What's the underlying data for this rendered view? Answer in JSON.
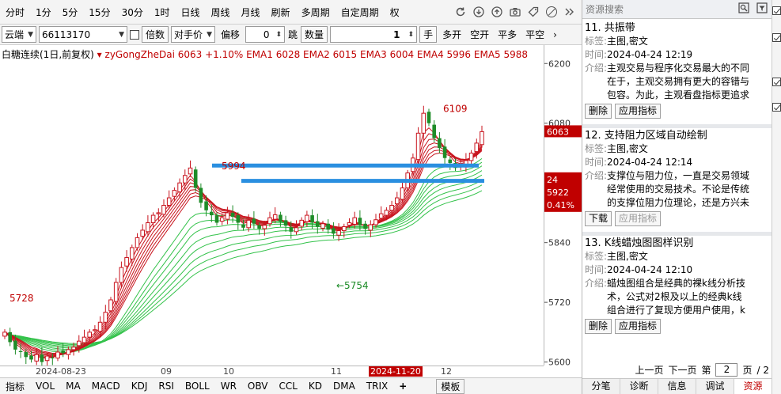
{
  "toolbar": {
    "items": [
      "分时",
      "1分",
      "5分",
      "15分",
      "30分",
      "1时",
      "日线",
      "周线",
      "月线",
      "刷新",
      "多周期",
      "自定周期",
      "权"
    ]
  },
  "controls": {
    "market": "云端",
    "code": "66113170",
    "multiplier_label": "倍数",
    "price_mode": "对手价",
    "offset_label": "偏移",
    "offset_value": "0",
    "jump_label": "跳",
    "qty_label": "数量",
    "qty_value": "1",
    "hand_label": "手",
    "actions": [
      "多开",
      "空开",
      "平多",
      "平空"
    ]
  },
  "chart_header": {
    "name": "白糖连续(1日,前复权)",
    "indicator": "zyGongZheDai",
    "values": "6063 +1.10%  EMA1 6028  EMA2 6015  EMA3 6004  EMA4 5996  EMA5 5988"
  },
  "chart_data": {
    "type": "candlestick",
    "title": "白糖连续(1日,前复权)",
    "indicator": "zyGongZheDai",
    "last_price": 6063,
    "change_pct": "+1.10%",
    "ema": {
      "EMA1": 6028,
      "EMA2": 6015,
      "EMA3": 6004,
      "EMA4": 5996,
      "EMA5": 5988
    },
    "y_ticks": [
      6200,
      6080,
      5960,
      5840,
      5720,
      5600
    ],
    "ylim": [
      5593,
      6237
    ],
    "x_labels": [
      "2024-08-23",
      "09",
      "10",
      "11",
      "2024-11-20",
      "12"
    ],
    "annotations": [
      {
        "text": "6109",
        "value": 6109
      },
      {
        "text": "5994",
        "value": 5994
      },
      {
        "text": "5754",
        "value": 5754
      },
      {
        "text": "5728",
        "value": 5728
      }
    ],
    "horizontal_lines": [
      5995,
      5964
    ],
    "price_tags": [
      "6063",
      "24",
      "5922",
      "0.41%"
    ],
    "closes": [
      5660,
      5640,
      5625,
      5620,
      5610,
      5605,
      5615,
      5600,
      5612,
      5608,
      5620,
      5618,
      5625,
      5630,
      5642,
      5650,
      5660,
      5665,
      5680,
      5700,
      5725,
      5760,
      5790,
      5810,
      5830,
      5850,
      5865,
      5880,
      5895,
      5900,
      5915,
      5930,
      5945,
      5960,
      5975,
      5990,
      5950,
      5920,
      5905,
      5895,
      5880,
      5890,
      5900,
      5892,
      5880,
      5870,
      5885,
      5878,
      5868,
      5875,
      5890,
      5896,
      5882,
      5874,
      5862,
      5870,
      5885,
      5895,
      5880,
      5872,
      5878,
      5866,
      5858,
      5864,
      5872,
      5880,
      5890,
      5875,
      5868,
      5876,
      5886,
      5898,
      5905,
      5915,
      5930,
      5950,
      5980,
      6010,
      6060,
      6100,
      6080,
      6050,
      6030,
      6010,
      6000,
      5990,
      5995,
      6005,
      6020,
      6040,
      6063
    ]
  },
  "bottom_tabs": [
    "指标",
    "VOL",
    "MA",
    "MACD",
    "KDJ",
    "RSI",
    "BOLL",
    "WR",
    "OBV",
    "CCL",
    "KD",
    "DMA",
    "TRIX",
    "+",
    "模板"
  ],
  "resource_panel": {
    "search_placeholder": "资源搜索",
    "tag_label": "标签:",
    "time_label": "时间:",
    "intro_label": "介绍:",
    "items": [
      {
        "title": "11. 共振带",
        "tags": "主图,密文",
        "time": "2024-04-24 12:19",
        "intro": "主观交易与程序化交易最大的不同在于，主观交易拥有更大的容错与包容。为此，主观看盘指标更追求",
        "buttons": [
          "删除",
          "应用指标"
        ]
      },
      {
        "title": "12. 支持阻力区域自动绘制",
        "tags": "主图,密文",
        "time": "2024-04-24 12:14",
        "intro": "支撑位与阻力位，一直是交易领域经常使用的交易技术。不论是传统的支撑位阻力位理论，还是方兴未",
        "buttons": [
          "下载",
          "应用指标"
        ]
      },
      {
        "title": "13. K线蜡烛图图样识别",
        "tags": "主图,密文",
        "time": "2024-04-24 12:10",
        "intro": "蜡烛图组合是经典的裸k线分析技术，公式对2根及以上的经典k线组合进行了复现方便用户使用，k线",
        "buttons": [
          "删除",
          "应用指标"
        ]
      }
    ],
    "pager": {
      "prev": "上一页",
      "next": "下一页",
      "page_label": "第",
      "page_value": "2",
      "page_unit": "页",
      "total": "/ 2"
    },
    "tabs": [
      "分笔",
      "诊断",
      "信息",
      "调试",
      "资源"
    ],
    "active_tab": "资源"
  }
}
